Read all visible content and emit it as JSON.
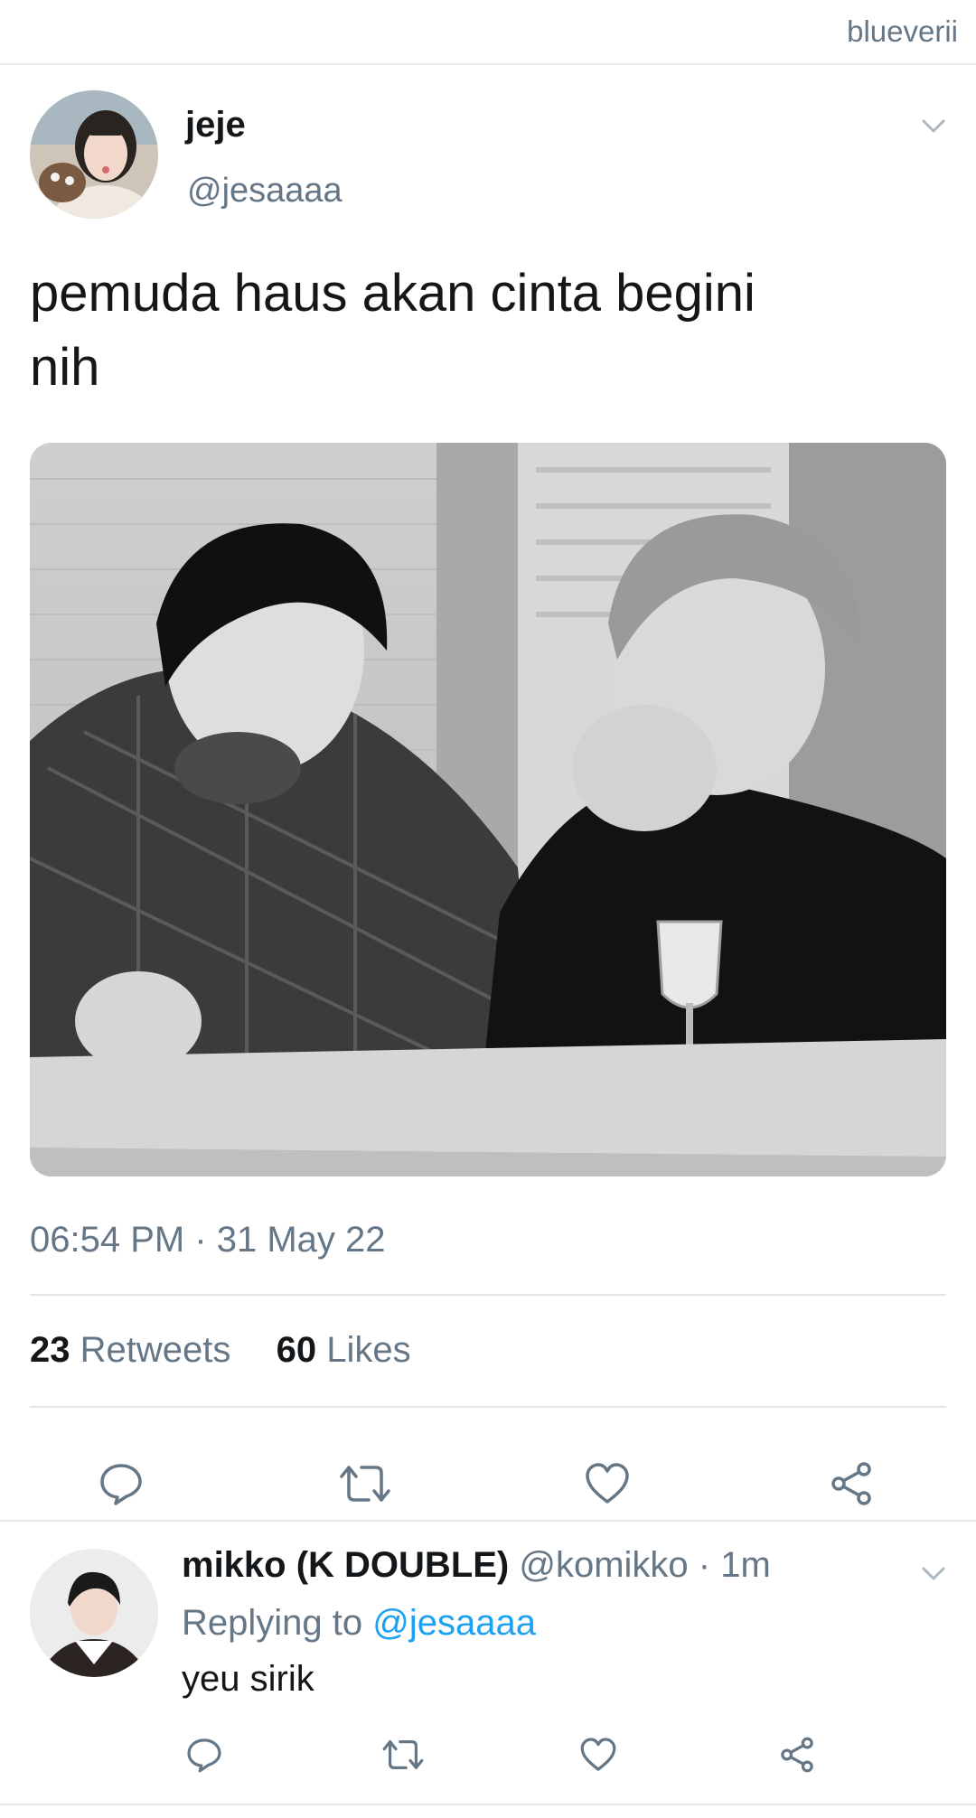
{
  "watermark": "blueverii",
  "tweet": {
    "display_name": "jeje",
    "handle": "@jesaaaa",
    "text_line1": "pemuda haus akan cinta begini",
    "text_line2": "nih",
    "timestamp": "06:54 PM · 31 May 22",
    "retweets_count": "23",
    "retweets_label": "Retweets",
    "likes_count": "60",
    "likes_label": "Likes",
    "actions": [
      "reply-icon",
      "retweet-icon",
      "like-icon",
      "share-icon"
    ]
  },
  "reply": {
    "display_name": "mikko (K DOUBLE)",
    "handle_time": "@komikko · 1m",
    "replying_prefix": "Replying to",
    "replying_mention": "@jesaaaa",
    "text": "yeu sirik",
    "actions": [
      "reply-icon",
      "retweet-icon",
      "like-icon",
      "share-icon"
    ]
  },
  "colors": {
    "text_primary": "#14171a",
    "text_secondary": "#657786",
    "link": "#1da1f2",
    "divider": "#e1e8ed"
  }
}
